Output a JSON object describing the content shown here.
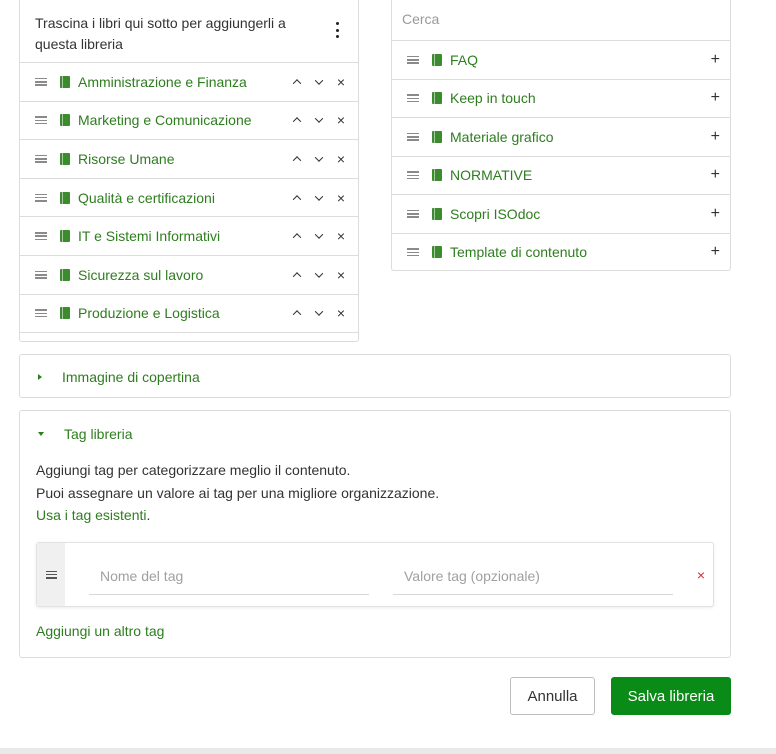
{
  "left_panel": {
    "hint": "Trascina i libri qui sotto per aggiungerli a questa libreria",
    "books": [
      {
        "label": "Amministrazione e Finanza"
      },
      {
        "label": "Marketing e Comunicazione"
      },
      {
        "label": "Risorse Umane"
      },
      {
        "label": "Qualità e certificazioni"
      },
      {
        "label": "IT e Sistemi Informativi"
      },
      {
        "label": "Sicurezza sul lavoro"
      },
      {
        "label": "Produzione e Logistica"
      }
    ],
    "controls": {
      "up": "",
      "down": "",
      "remove": "×"
    }
  },
  "right_panel": {
    "search_placeholder": "Cerca",
    "books": [
      {
        "label": "FAQ"
      },
      {
        "label": "Keep in touch"
      },
      {
        "label": "Materiale grafico"
      },
      {
        "label": "NORMATIVE"
      },
      {
        "label": "Scopri ISOdoc"
      },
      {
        "label": "Template di contenuto"
      }
    ],
    "add_symbol": "+"
  },
  "cover_section": {
    "title": "Immagine di copertina"
  },
  "tags_section": {
    "title": "Tag libreria",
    "desc_line1": "Aggiungi tag per categorizzare meglio il contenuto.",
    "desc_line2": "Puoi assegnare un valore ai tag per una migliore organizzazione.",
    "existing_link": "Usa i tag esistenti",
    "existing_suffix": ".",
    "name_placeholder": "Nome del tag",
    "value_placeholder": "Valore tag (opzionale)",
    "remove_symbol": "×",
    "add_another": "Aggiungi un altro tag"
  },
  "actions": {
    "cancel": "Annulla",
    "save": "Salva libreria"
  },
  "colors": {
    "accent_green": "#2e7d1f",
    "save_button": "#0a8a16",
    "remove_red": "#d03030"
  }
}
